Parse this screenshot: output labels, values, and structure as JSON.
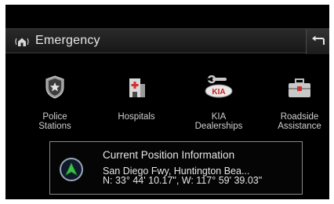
{
  "header": {
    "title": "Emergency",
    "icon": "house-antenna-icon",
    "back_icon": "back-arrow-icon"
  },
  "categories": [
    {
      "id": "police",
      "label_line1": "Police",
      "label_line2": "Stations",
      "icon": "police-badge-icon"
    },
    {
      "id": "hospitals",
      "label_line1": "Hospitals",
      "label_line2": "",
      "icon": "hospital-icon"
    },
    {
      "id": "kia",
      "label_line1": "KIA",
      "label_line2": "Dealerships",
      "icon": "kia-wrench-icon"
    },
    {
      "id": "roadside",
      "label_line1": "Roadside",
      "label_line2": "Assistance",
      "icon": "toolbox-icon"
    }
  ],
  "position": {
    "title": "Current Position Information",
    "address": "San Diego Fwy, Huntington Bea...",
    "coordinates": "N: 33° 44' 10.17\", W: 117° 59' 39.03\"",
    "icon": "navigation-arrow-icon"
  },
  "colors": {
    "background": "#000000",
    "header": "#222222",
    "nav_green": "#3cc24a"
  }
}
